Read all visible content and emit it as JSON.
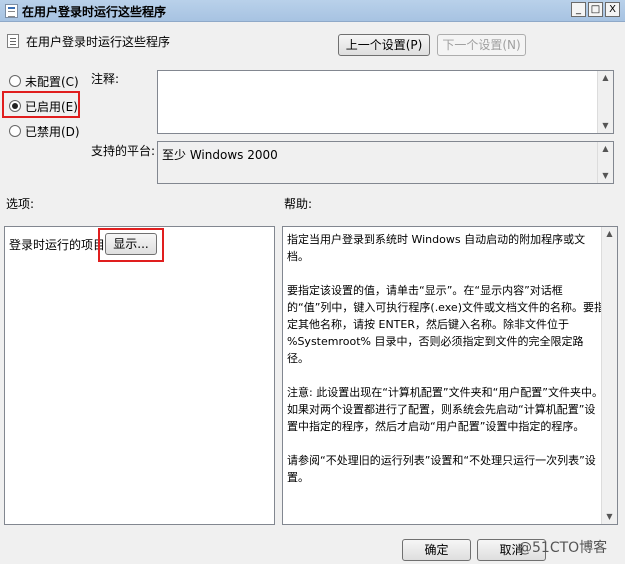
{
  "window": {
    "title": "在用户登录时运行这些程序",
    "minimize": "_",
    "restore": "□",
    "close": "X"
  },
  "header": {
    "setting_name": "在用户登录时运行这些程序",
    "prev_button": "上一个设置(P)",
    "next_button": "下一个设置(N)"
  },
  "state": {
    "not_configured": "未配置(C)",
    "enabled": "已启用(E)",
    "disabled": "已禁用(D)",
    "selected": "enabled"
  },
  "comment": {
    "label": "注释:",
    "value": ""
  },
  "platform": {
    "label": "支持的平台:",
    "value": "至少 Windows 2000"
  },
  "options": {
    "label": "选项:",
    "items_label": "登录时运行的项目",
    "show_button": "显示..."
  },
  "help": {
    "label": "帮助:",
    "paragraphs": [
      "指定当用户登录到系统时 Windows 自动启动的附加程序或文档。",
      "要指定该设置的值，请单击“显示”。在“显示内容”对话框的“值”列中，键入可执行程序(.exe)文件或文档文件的名称。要指定其他名称，请按 ENTER，然后键入名称。除非文件位于 %Systemroot% 目录中，否则必须指定到文件的完全限定路径。",
      "注意: 此设置出现在“计算机配置”文件夹和“用户配置”文件夹中。如果对两个设置都进行了配置，则系统会先启动“计算机配置”设置中指定的程序，然后才启动“用户配置”设置中指定的程序。",
      "请参阅“不处理旧的运行列表”设置和“不处理只运行一次列表”设置。"
    ]
  },
  "footer": {
    "ok_button": "确定",
    "cancel_button": "取消"
  },
  "watermark": "@51CTO博客",
  "colors": {
    "highlight_box": "#e01e1e"
  }
}
